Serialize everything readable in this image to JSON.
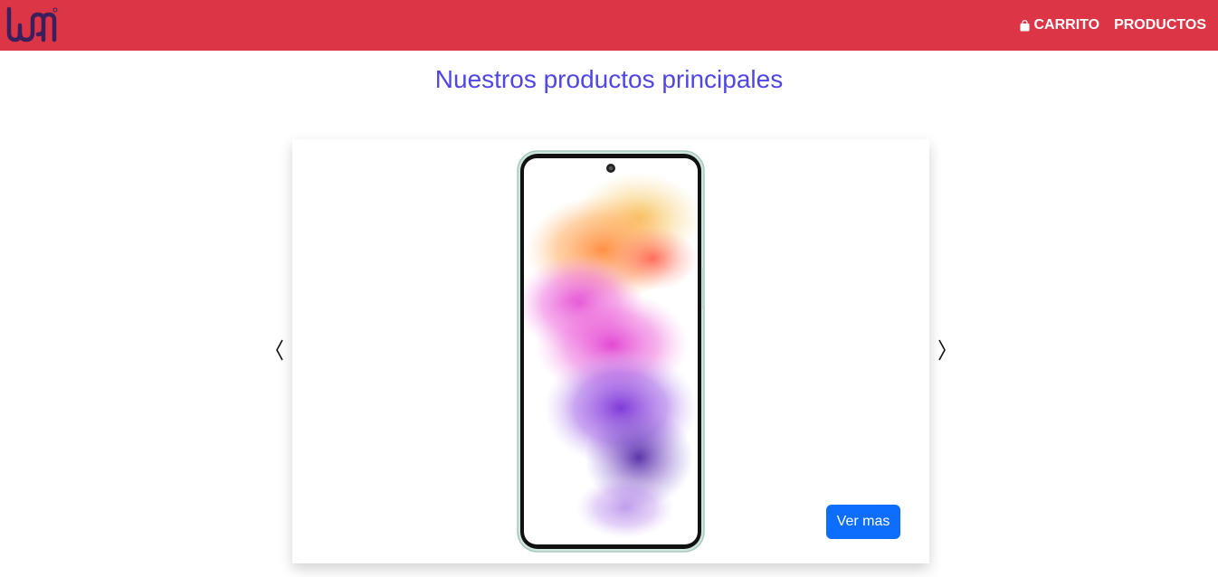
{
  "brand": {
    "logo_text": "LOGO",
    "icon": "logo-mark"
  },
  "nav": {
    "items": [
      {
        "label": "CARRITO",
        "icon": "shopping-bag-icon"
      },
      {
        "label": "PRODUCTOS"
      }
    ]
  },
  "main": {
    "title": "Nuestros productos principales",
    "carousel": {
      "prev_icon": "chevron-left-icon",
      "next_icon": "chevron-right-icon",
      "button_label": "Ver mas"
    }
  },
  "colors": {
    "navbar": "#dc3545",
    "title": "#4f46e5",
    "button": "#0d6efd",
    "logo": "#3b1f5c"
  }
}
